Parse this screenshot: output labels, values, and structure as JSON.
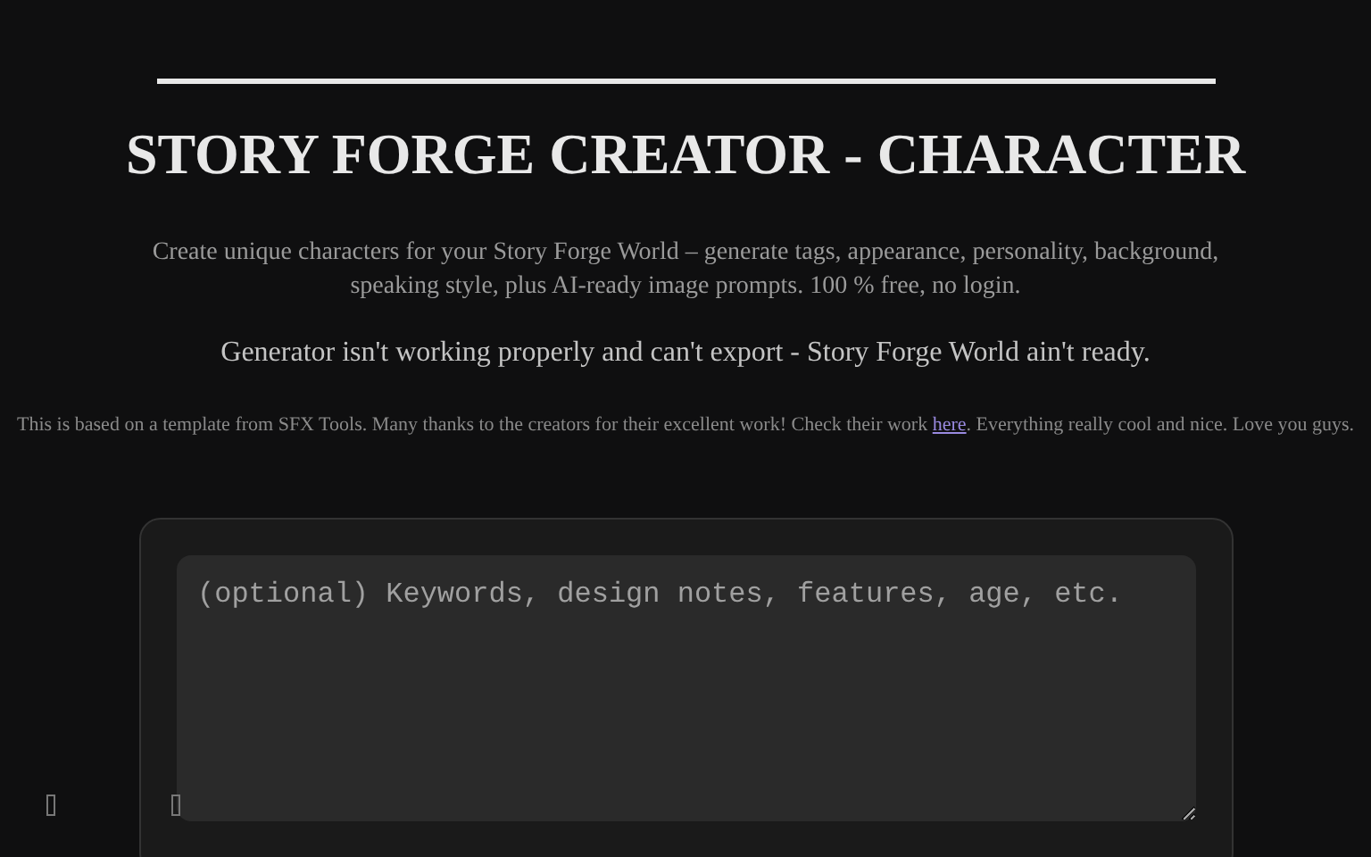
{
  "title": "STORY FORGE CREATOR - CHARACTER",
  "intro": "Create unique characters for your Story Forge World – generate tags, appearance, personality, background, speaking style, plus AI-ready image prompts. 100 % free, no login.",
  "notice": "Generator isn't working properly and can't export - Story Forge World ain't ready.",
  "credit": {
    "before": "This is based on a template from SFX Tools. Many thanks to the creators for their excellent work! Check their work ",
    "link": "here",
    "after": ". Everything really cool and nice. Love you guys."
  },
  "prompt_field": {
    "placeholder": "(optional) Keywords, design notes, features, age, etc."
  }
}
